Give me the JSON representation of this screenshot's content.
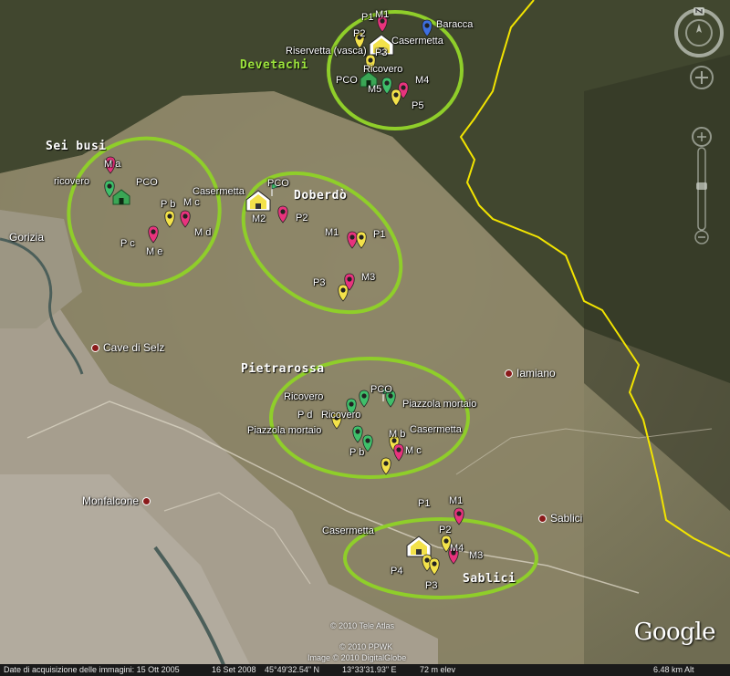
{
  "places": {
    "gorizia": "Gorizia",
    "cave": "Cave di Selz",
    "iamiano": "Iamiano",
    "monfalcone": "Monfalcone",
    "sablici": "Sablici"
  },
  "groups": {
    "devetachi": "Devetachi",
    "sei_busi": "Sei busi",
    "doberdo": "Doberdò",
    "pietrarossa": "Pietrarossa",
    "sablici": "Sablici"
  },
  "labels": {
    "devetachi": {
      "p1": "P1",
      "m1": "M1",
      "baracca": "Baracca",
      "p2": "P2",
      "casermetta": "Casermetta",
      "riservetta": "Riservetta (vasca)",
      "p3": "P3",
      "ricovero": "Ricovero",
      "pco": "PCO",
      "m5": "M5",
      "m4": "M4",
      "p5": "P5"
    },
    "sei_busi": {
      "ma": "M a",
      "ricovero": "ricovero",
      "pco": "PCO",
      "casermetta": "Casermetta",
      "pb": "P b",
      "mc": "M c",
      "pc": "P c",
      "md": "M d",
      "me": "M e"
    },
    "doberdo": {
      "pco": "PCO",
      "m2": "M2",
      "p2": "P2",
      "m1": "M1",
      "p1": "P1",
      "m3": "M3",
      "p3": "P3"
    },
    "pietrarossa": {
      "ricovero": "Ricovero",
      "pco": "PCO",
      "piazzola1": "Piazzola mortaio",
      "pd": "P d",
      "ricovero2": "Ricovero",
      "piazzola2": "Piazzola mortaio",
      "mb": "M b",
      "casermetta": "Casermetta",
      "pb": "P b",
      "mc": "M c"
    },
    "sablici": {
      "p1": "P1",
      "m1": "M1",
      "casermetta": "Casermetta",
      "p2": "P2",
      "m4": "M4",
      "m3": "M3",
      "p4": "P4",
      "p3": "P3"
    }
  },
  "logo": "Google",
  "copyright": {
    "tele_atlas": "© 2010 Tele Atlas",
    "ppwk": "© 2010 PPWK",
    "digitalglobe": "Image © 2010 DigitalGlobe"
  },
  "status": {
    "acquisition": "Date di acquisizione delle immagini: 15 Ott 2005",
    "date2": "16 Set 2008",
    "lat": "45°49'32.54\" N",
    "lon": "13°33'31.93\" E",
    "elev": "72 m elev",
    "alt": "6.48 km Alt"
  },
  "colors": {
    "ellipse": "#8fce2a",
    "border": "#f2e400",
    "pin_pink": "#e8337d",
    "pin_yellow": "#f3e24a",
    "pin_green": "#3fbf6a",
    "pin_blue": "#3d6fe0",
    "group_label": "#9be23c"
  },
  "icons": {
    "pin": "map-pin-icon",
    "house": "house-icon",
    "flag": "flag-icon",
    "compass": "compass-icon",
    "zoom": "zoom-slider-icon"
  }
}
